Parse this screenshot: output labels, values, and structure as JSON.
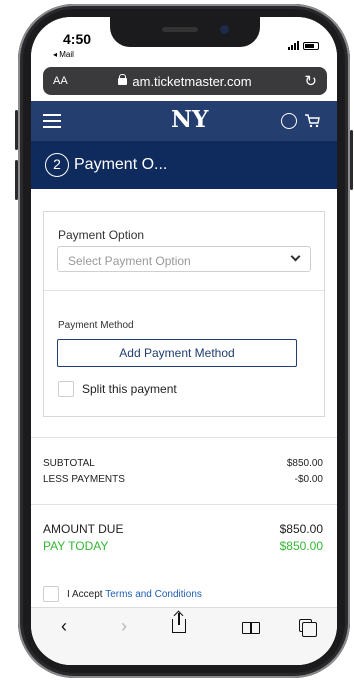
{
  "status_bar": {
    "time": "4:50",
    "back_app": "◂ Mail"
  },
  "browser": {
    "text_size_label": "AA",
    "url": "am.ticketmaster.com",
    "reload_glyph": "↻"
  },
  "site_header": {
    "logo_text": "NY"
  },
  "step": {
    "number": "2",
    "title": "Payment O..."
  },
  "payment_option": {
    "label": "Payment Option",
    "placeholder": "Select Payment Option"
  },
  "payment_method": {
    "label": "Payment Method",
    "add_button": "Add Payment Method",
    "split_label": "Split this payment"
  },
  "totals": {
    "subtotal_label": "SUBTOTAL",
    "subtotal_value": "$850.00",
    "less_payments_label": "LESS PAYMENTS",
    "less_payments_value": "-$0.00",
    "amount_due_label": "AMOUNT DUE",
    "amount_due_value": "$850.00",
    "pay_today_label": "PAY TODAY",
    "pay_today_value": "$850.00"
  },
  "terms": {
    "prefix": "I Accept ",
    "link": "Terms and Conditions"
  },
  "toolbar": {
    "back": "‹",
    "forward": "›"
  },
  "colors": {
    "header": "#243e6f",
    "step_bar": "#0f2a5c",
    "accent_green": "#33b733",
    "link": "#1f5fb4"
  }
}
